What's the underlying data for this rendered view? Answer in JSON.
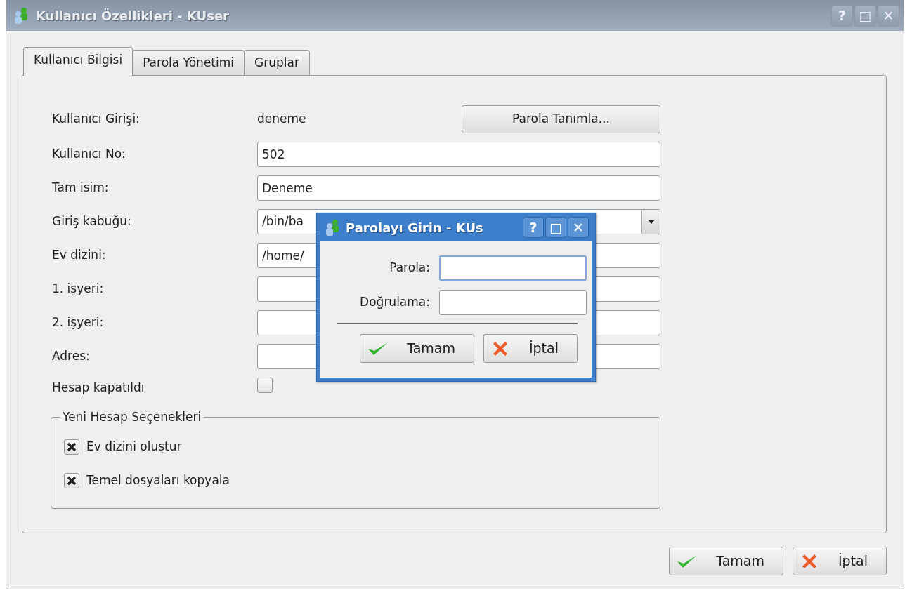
{
  "window": {
    "title": "Kullanıcı Özellikleri - KUser",
    "title_buttons": [
      "?",
      "□",
      "✕"
    ]
  },
  "tabs": [
    {
      "label": "Kullanıcı Bilgisi",
      "selected": true
    },
    {
      "label": "Parola Yönetimi",
      "selected": false
    },
    {
      "label": "Gruplar",
      "selected": false
    }
  ],
  "fields": [
    {
      "kind": "static",
      "label": "Kullanıcı Girişi:",
      "value": "deneme",
      "button": {
        "label": "Parola Tanımla..."
      }
    },
    {
      "kind": "input",
      "label": "Kullanıcı No:",
      "value": "502"
    },
    {
      "kind": "input",
      "label": "Tam isim:",
      "value": "Deneme"
    },
    {
      "kind": "combo",
      "label": "Giriş kabuğu:",
      "value": "/bin/ba"
    },
    {
      "kind": "input",
      "label": "Ev dizini:",
      "value": "/home/"
    },
    {
      "kind": "input",
      "label": "1. işyeri:"
    },
    {
      "kind": "input",
      "label": "2. işyeri:"
    },
    {
      "kind": "input",
      "label": "Adres:"
    },
    {
      "kind": "checkbox",
      "label": "Hesap kapatıldı",
      "checked": false
    }
  ],
  "group": {
    "title": "Yeni Hesap Seçenekleri",
    "options": [
      {
        "label": "Ev dizini oluştur",
        "checked": true
      },
      {
        "label": "Temel dosyaları kopyala",
        "checked": true
      }
    ]
  },
  "buttons": [
    {
      "kind": "ok",
      "label": "Tamam"
    },
    {
      "kind": "cancel",
      "label": "İptal"
    }
  ],
  "dialog": {
    "title": "Parolayı Girin - KUs",
    "title_buttons": [
      "?",
      "□",
      "✕"
    ],
    "fields": [
      {
        "label": "Parola:",
        "focused": true
      },
      {
        "label": "Doğrulama:",
        "focused": false
      }
    ],
    "buttons": [
      {
        "kind": "ok",
        "label": "Tamam"
      },
      {
        "kind": "cancel",
        "label": "İptal"
      }
    ]
  }
}
